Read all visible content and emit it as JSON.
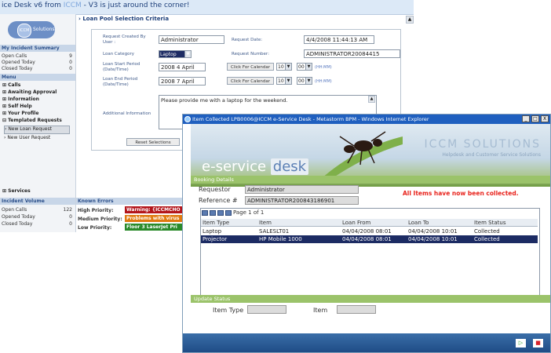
{
  "banner_text": {
    "pre": "ice Desk v6 from ",
    "brand": "ICCM",
    "post": " - V3 is just around the corner!"
  },
  "logo": {
    "circle": "ICCM",
    "text": "Solutions"
  },
  "sidebar": {
    "summary_title": "My Incident Summary",
    "summary_rows": [
      {
        "label": "Open Calls",
        "value": "9"
      },
      {
        "label": "Opened Today",
        "value": "0"
      },
      {
        "label": "Closed Today",
        "value": "0"
      }
    ],
    "menu_title": "Menu",
    "menu": [
      "Calls",
      "Awaiting Approval",
      "Information",
      "Self Help",
      "Your Profile",
      "Templated Requests"
    ],
    "templated": [
      "New Loan Request",
      "New User Request"
    ],
    "services": "Services"
  },
  "criteria": {
    "title": "Loan Pool Selection Criteria",
    "created_by_label": "Request Created By User :",
    "created_by_value": "Administrator",
    "request_date_label": "Request Date:",
    "request_date_value": "4/4/2008 11:44:13 AM",
    "loan_category_label": "Loan Category",
    "loan_category_value": "Laptop",
    "request_number_label": "Request Number:",
    "request_number_value": "ADMINISTRATOR20084415",
    "loan_start_label": "Loan Start Period (Date/Time)",
    "loan_start_value": "2008 4 April",
    "loan_end_label": "Loan End Period (Date/Time)",
    "loan_end_value": "2008 7 April",
    "calendar_button": "Click For Calendar",
    "hour_start": "10",
    "minute_start": "00",
    "hour_end": "10",
    "minute_end": "00",
    "time_hint": "(HH:MM)",
    "additional_label": "Additional Information",
    "additional_value": "Please provide me with a laptop for the weekend.",
    "reset_button": "Reset Selections"
  },
  "incident_volume": {
    "title": "Incident Volume",
    "rows": [
      {
        "label": "Open Calls",
        "value": "122"
      },
      {
        "label": "Opened Today",
        "value": "0"
      },
      {
        "label": "Closed Today",
        "value": "0"
      }
    ]
  },
  "known_errors": {
    "title": "Known Errors",
    "rows": [
      {
        "label": "High Priority:",
        "text": "Warning: {ICCMCHO",
        "color": "#b3151b"
      },
      {
        "label": "Medium Priority:",
        "text": "Problems with virus",
        "color": "#e07a10"
      },
      {
        "label": "Low Priority:",
        "text": "Floor 3 LaserJet Pri",
        "color": "#2a8a2a"
      }
    ]
  },
  "front_window": {
    "title": "Item Collected LPB0006@ICCM e-Service Desk - Metastorm BPM - Windows Internet Explorer",
    "win_buttons": [
      "_",
      "□",
      "X"
    ],
    "banner": {
      "e": "e-service ",
      "desk": "desk",
      "brand": "ICCM SOLUTIONS",
      "tagline": "Helpdesk and Customer Service Solutions"
    },
    "booking_title": "Booking Details",
    "requestor_label": "Requestor",
    "requestor_value": "Administrator",
    "reference_label": "Reference #",
    "reference_value": "ADMINISTRATOR200843186901",
    "message": "All Items have now been collected.",
    "pager": "Page 1 of 1",
    "columns": [
      "Item Type",
      "Item",
      "Loan From",
      "Loan To",
      "Item Status"
    ],
    "rows": [
      [
        "Laptop",
        "SALESLT01",
        "04/04/2008 08:01",
        "04/04/2008 10:01",
        "Collected"
      ],
      [
        "Projector",
        "HP Mobile 1000",
        "04/04/2008 08:01",
        "04/04/2008 10:01",
        "Collected"
      ]
    ],
    "update_title": "Update Status",
    "item_type_label": "Item Type",
    "item_label": "Item",
    "nav_next": "▷",
    "nav_stop": "■"
  },
  "colors": {
    "accent": "#1f5fbf",
    "green": "#9bc36a",
    "error": "#e8221b",
    "selected_row": "#1c2b63"
  }
}
